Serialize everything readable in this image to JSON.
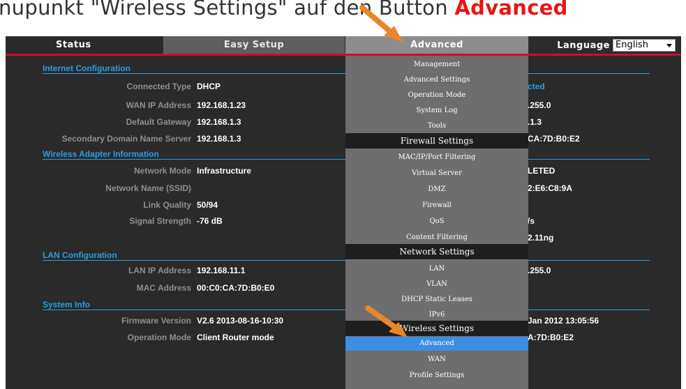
{
  "banner": {
    "before": "nupunkt \"Wireless Settings\" auf den Button ",
    "highlight": "Advanced"
  },
  "nav": {
    "tabs": [
      "Status",
      "Easy Setup",
      "Advanced"
    ],
    "language_label": "Language",
    "language_value": "English"
  },
  "internet": {
    "title": "Internet Configuration",
    "rows": [
      {
        "label": "Connected Type",
        "value": "DHCP"
      },
      {
        "label": "WAN IP Address",
        "value": "192.168.1.23"
      },
      {
        "label": "Default Gateway",
        "value": "192.168.1.3"
      },
      {
        "label": "Secondary Domain Name Server",
        "value": "192.168.1.3"
      }
    ],
    "right": [
      "cted",
      ".255.0",
      ".1.3",
      "CA:7D:B0:E2"
    ]
  },
  "wireless": {
    "title": "Wireless Adapter Information",
    "rows": [
      {
        "label": "Network Mode",
        "value": "Infrastructure"
      },
      {
        "label": "Network Name (SSID)",
        "value": ""
      },
      {
        "label": "Link Quality",
        "value": "50/94"
      },
      {
        "label": "Signal Strength",
        "value": "-76 dB"
      }
    ],
    "right": [
      "LETED",
      "2:E6:C8:9A",
      "/s",
      "2.11ng"
    ]
  },
  "lan": {
    "title": "LAN Configuration",
    "rows": [
      {
        "label": "LAN IP Address",
        "value": "192.168.11.1"
      },
      {
        "label": "MAC Address",
        "value": "00:C0:CA:7D:B0:E0"
      }
    ],
    "right": [
      ".255.0"
    ]
  },
  "system": {
    "title": "System Info",
    "rows": [
      {
        "label": "Firmware Version",
        "value": "V2.6  2013-08-16-10:30"
      },
      {
        "label": "Operation Mode",
        "value": "Client Router mode"
      }
    ],
    "right": [
      "Jan 2012 13:05:56",
      "A:7D:B0:E2"
    ]
  },
  "menu": {
    "items": [
      "Management",
      "Advanced Settings",
      "Operation Mode",
      "System Log",
      "Tools",
      "Firewall Settings",
      "MAC/IP/Port Filtering",
      "Virtual Server",
      "DMZ",
      "Firewall",
      "QoS",
      "Content Filtering",
      "Network Settings",
      "LAN",
      "VLAN",
      "DHCP Static Leases",
      "IPv6",
      "Wireless Settings",
      "Advanced",
      "WAN",
      "Profile Settings"
    ],
    "selected": "Advanced"
  },
  "colors": {
    "accent_blue": "#2a9ee0",
    "highlight_red": "#e81515",
    "nav_red_line": "#c8102e",
    "arrow_orange": "#e8862b",
    "selected_item": "#3b8ee0"
  }
}
